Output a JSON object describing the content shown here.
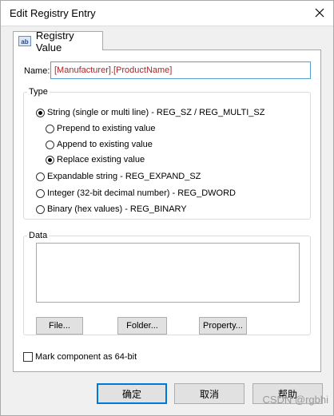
{
  "dialog": {
    "title": "Edit Registry Entry",
    "close_icon": "close-icon"
  },
  "tab": {
    "icon": "string-value-icon",
    "icon_glyph": "ab",
    "label": "Registry Value"
  },
  "name_field": {
    "label": "Name:",
    "value": "[Manufacturer].[ProductName]"
  },
  "type_group": {
    "legend": "Type",
    "options": [
      {
        "label": "String (single or multi line) - REG_SZ / REG_MULTI_SZ",
        "checked": true
      },
      {
        "label": "Prepend to existing value",
        "checked": false
      },
      {
        "label": "Append to existing value",
        "checked": false
      },
      {
        "label": "Replace existing value",
        "checked": true
      },
      {
        "label": "Expandable string - REG_EXPAND_SZ",
        "checked": false
      },
      {
        "label": "Integer (32-bit decimal number) - REG_DWORD",
        "checked": false
      },
      {
        "label": "Binary (hex values) - REG_BINARY",
        "checked": false
      }
    ]
  },
  "data_group": {
    "legend": "Data",
    "value": "",
    "file_button": "File...",
    "folder_button": "Folder...",
    "property_button": "Property..."
  },
  "checkbox": {
    "label": "Mark component as 64-bit",
    "checked": false
  },
  "buttons": {
    "ok": "确定",
    "cancel": "取消",
    "help": "帮助"
  },
  "watermark": "CSDN @rgbhi",
  "colors": {
    "name_text": "#b22222",
    "focus_border": "#4f9fcf",
    "default_button_border": "#0078d7"
  }
}
